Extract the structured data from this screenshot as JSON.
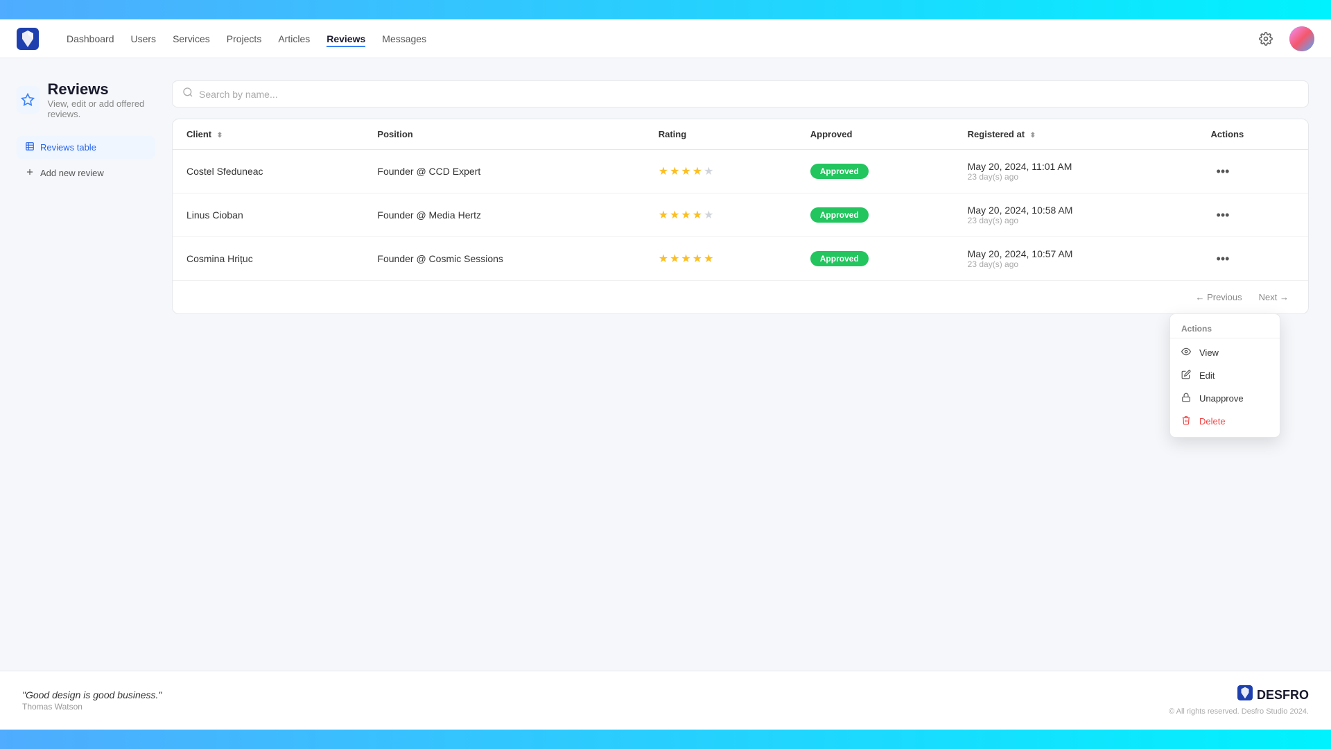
{
  "topbar": {},
  "navbar": {
    "links": [
      {
        "label": "Dashboard",
        "active": false
      },
      {
        "label": "Users",
        "active": false
      },
      {
        "label": "Services",
        "active": false
      },
      {
        "label": "Projects",
        "active": false
      },
      {
        "label": "Articles",
        "active": false
      },
      {
        "label": "Reviews",
        "active": true
      },
      {
        "label": "Messages",
        "active": false
      }
    ]
  },
  "page": {
    "title": "Reviews",
    "subtitle": "View, edit or add offered reviews."
  },
  "sidebar": {
    "items": [
      {
        "label": "Reviews table",
        "active": true,
        "icon": "table"
      },
      {
        "label": "Add new review",
        "active": false,
        "icon": "plus"
      }
    ]
  },
  "search": {
    "placeholder": "Search by name..."
  },
  "table": {
    "columns": [
      {
        "label": "Client",
        "sortable": true
      },
      {
        "label": "Position",
        "sortable": false
      },
      {
        "label": "Rating",
        "sortable": false
      },
      {
        "label": "Approved",
        "sortable": false
      },
      {
        "label": "Registered at",
        "sortable": true
      },
      {
        "label": "Actions",
        "sortable": false
      }
    ],
    "rows": [
      {
        "client": "Costel Sfeduneac",
        "position": "Founder @ CCD Expert",
        "rating": 4,
        "approved": true,
        "registered_date": "May 20, 2024, 11:01 AM",
        "registered_ago": "23 day(s) ago"
      },
      {
        "client": "Linus Cioban",
        "position": "Founder @ Media Hertz",
        "rating": 4,
        "approved": true,
        "registered_date": "May 20, 2024, 10:58 AM",
        "registered_ago": "23 day(s) ago"
      },
      {
        "client": "Cosmina Hrituc",
        "position": "Founder @ Cosmic Sessions",
        "rating": 5,
        "approved": true,
        "registered_date": "May 20, 2024, 10:57 AM",
        "registered_ago": "23 day(s) ago"
      }
    ]
  },
  "dropdown": {
    "title": "Actions",
    "items": [
      {
        "label": "View",
        "icon": "eye"
      },
      {
        "label": "Edit",
        "icon": "edit"
      },
      {
        "label": "Unapprove",
        "icon": "lock"
      },
      {
        "label": "Delete",
        "icon": "trash"
      }
    ]
  },
  "pagination": {
    "prev": "← Previous",
    "next": "Next →"
  },
  "footer": {
    "quote": "\"Good design is good business.\"",
    "author": "Thomas Watson",
    "brand": "DESFRO",
    "copyright": "© All rights reserved. Desfro Studio 2024."
  }
}
